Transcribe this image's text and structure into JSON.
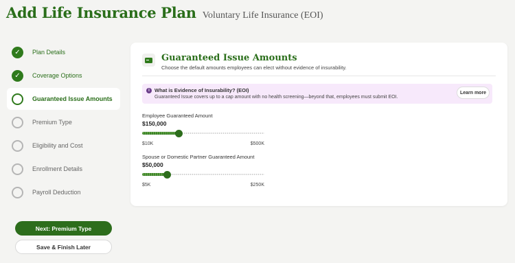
{
  "header": {
    "title": "Add Life Insurance Plan",
    "subtitle": "Voluntary Life Insurance (EOI)"
  },
  "steps": [
    {
      "label": "Plan Details",
      "status": "done"
    },
    {
      "label": "Coverage Options",
      "status": "done"
    },
    {
      "label": "Guaranteed Issue Amounts",
      "status": "current"
    },
    {
      "label": "Premium Type",
      "status": "todo"
    },
    {
      "label": "Eligibility and Cost",
      "status": "todo"
    },
    {
      "label": "Enrollment Details",
      "status": "todo"
    },
    {
      "label": "Payroll Deduction",
      "status": "todo"
    }
  ],
  "check_glyph": "✓",
  "buttons": {
    "next": "Next: Premium Type",
    "save": "Save & Finish Later"
  },
  "card": {
    "icon": "cash-icon",
    "title": "Guaranteed Issue Amounts",
    "description": "Choose the default amounts employees can elect without evidence of insurability."
  },
  "info": {
    "icon_glyph": "i",
    "title": "What is Evidence of Insurability? (EOI)",
    "text": "Guaranteed Issue covers up to a cap amount with no health screening—beyond that, employees must submit EOI.",
    "button": "Learn more"
  },
  "sliders": {
    "employee": {
      "label": "Employee Guaranteed Amount",
      "value_text": "$150,000",
      "min_label": "$10K",
      "max_label": "$500K",
      "level": 0.3
    },
    "spouse": {
      "label": "Spouse or Domestic Partner Guaranteed Amount",
      "value_text": "$50,000",
      "min_label": "$5K",
      "max_label": "$250K",
      "level": 0.2
    }
  },
  "colors": {
    "accent": "#2f7a1c",
    "info_bg": "#f7e9fb",
    "info_icon": "#6b3f8a"
  }
}
